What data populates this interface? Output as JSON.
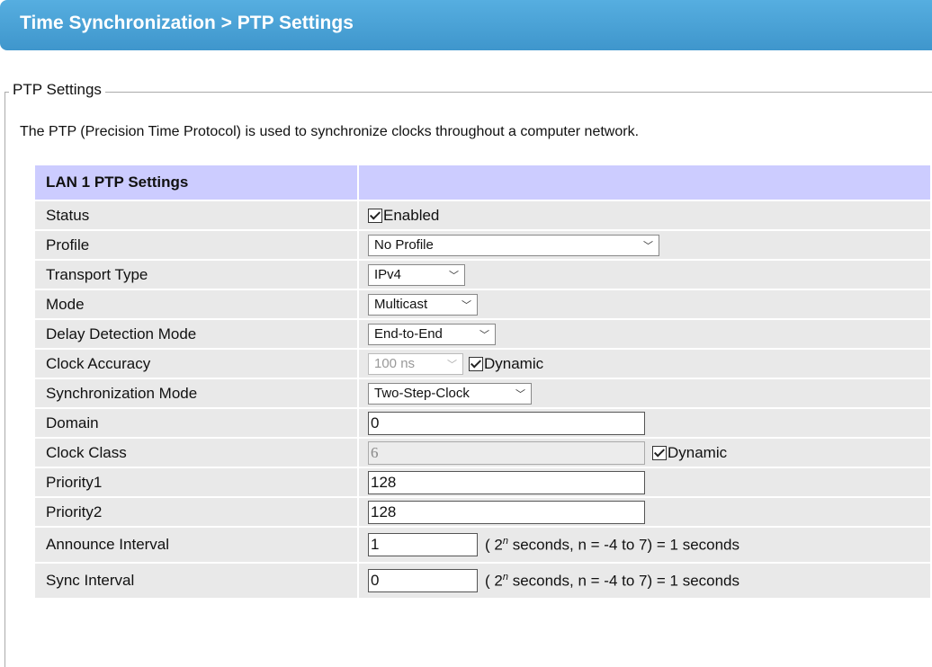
{
  "header": {
    "title": "Time Synchronization > PTP Settings"
  },
  "fieldset": {
    "legend": "PTP Settings"
  },
  "description": "The PTP (Precision Time Protocol) is used to synchronize clocks throughout a computer network.",
  "table": {
    "heading": "LAN 1 PTP Settings",
    "status": {
      "label": "Status",
      "checkbox_label": "Enabled",
      "checked": true
    },
    "profile": {
      "label": "Profile",
      "value": "No Profile"
    },
    "transport": {
      "label": "Transport Type",
      "value": "IPv4"
    },
    "mode": {
      "label": "Mode",
      "value": "Multicast"
    },
    "delay": {
      "label": "Delay Detection Mode",
      "value": "End-to-End"
    },
    "accuracy": {
      "label": "Clock Accuracy",
      "value": "100 ns",
      "dynamic_label": "Dynamic",
      "dynamic_checked": true
    },
    "sync_mode": {
      "label": "Synchronization Mode",
      "value": "Two-Step-Clock"
    },
    "domain": {
      "label": "Domain",
      "value": "0"
    },
    "clock_class": {
      "label": "Clock Class",
      "value": "6",
      "dynamic_label": "Dynamic",
      "dynamic_checked": true
    },
    "priority1": {
      "label": "Priority1",
      "value": "128"
    },
    "priority2": {
      "label": "Priority2",
      "value": "128"
    },
    "announce": {
      "label": "Announce Interval",
      "value": "1",
      "hint_prefix": "( 2",
      "hint_exp": "n",
      "hint_suffix": " seconds, n = -4 to 7) = 1  seconds"
    },
    "sync_interval": {
      "label": "Sync Interval",
      "value": "0",
      "hint_prefix": "( 2",
      "hint_exp": "n",
      "hint_suffix": " seconds, n = -4 to 7) = 1  seconds"
    }
  }
}
